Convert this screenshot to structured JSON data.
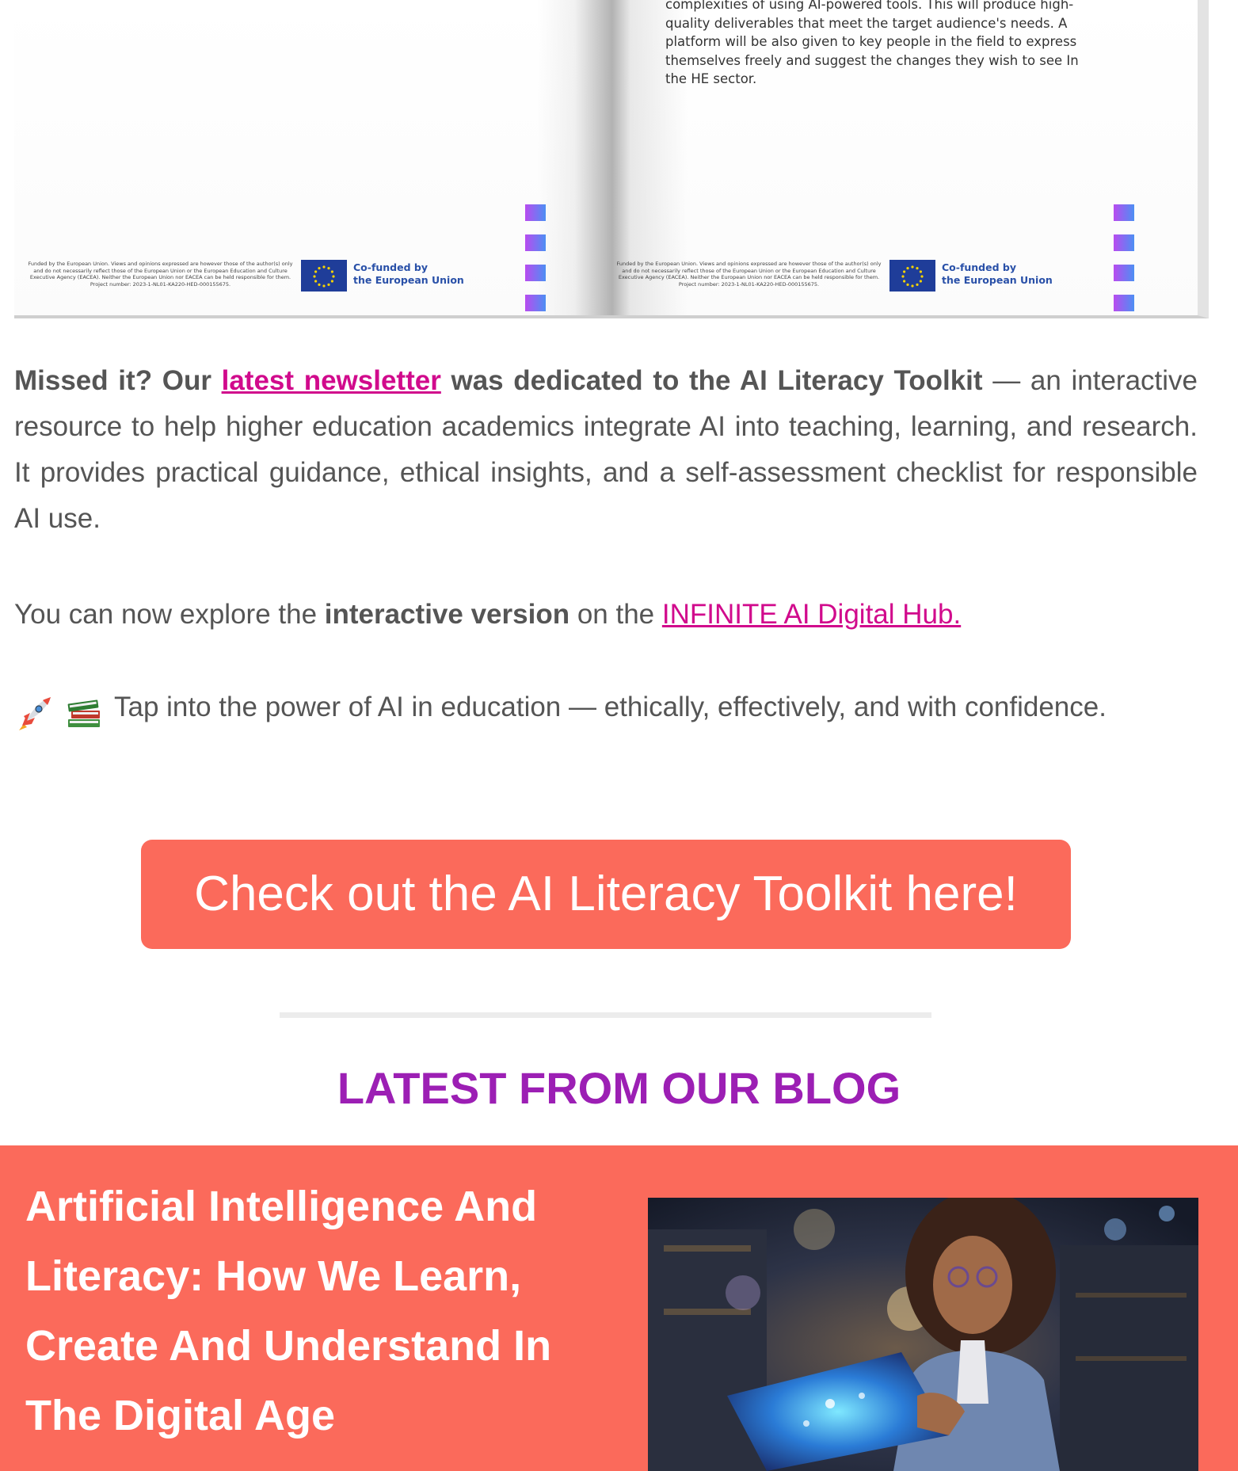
{
  "book": {
    "page_text_lines": [
      "complexities of using AI-powered tools. This will produce high-",
      "quality deliverables that meet the target audience's needs. A",
      "platform will be also given to key people in the field to express",
      "themselves freely and suggest the changes they wish to see In",
      "the HE sector."
    ],
    "disclaimer": "Funded by the European Union. Views and opinions expressed are however those of the author(s) only and do not necessarily reflect those of the European Union or the European Education and Culture Executive Agency (EACEA). Neither the European Union nor EACEA can be held responsible for them. Project number: 2023-1-NL01-KA220-HED-000155675.",
    "cofunded_line1": "Co-funded by",
    "cofunded_line2": "the European Union",
    "square_color_from": "#b84cf0",
    "square_color_to": "#4d8ff3"
  },
  "newsletter": {
    "prefix": "Missed it? Our ",
    "link_text": "latest newsletter",
    "suffix": " was dedicated to the AI Literacy Toolkit",
    "dash": " —",
    "body": " an interactive resource to help higher education academics integrate AI into teaching, learning, and research. It provides practical guidance, ethical insights, and a self-assessment checklist for responsible AI use."
  },
  "explore": {
    "prefix": "You can now explore the ",
    "bold": "interactive version",
    "middle": " on the ",
    "link_text": "INFINITE AI Digital Hub."
  },
  "tap": {
    "icons": [
      "rocket-icon",
      "books-icon"
    ],
    "text": "Tap into the power of AI in education — ethically, effectively, and with confidence."
  },
  "cta": {
    "label": "Check out the AI Literacy Toolkit here!",
    "color": "#fb6a5b"
  },
  "blog": {
    "heading": "LATEST FROM OUR BLOG",
    "heading_color": "#9c1fb4",
    "card_color": "#fb6a5b",
    "post_title": "Artificial Intelligence And Literacy: How We Learn, Create And Understand In The Digital Age"
  },
  "colors": {
    "link": "#d10a8c",
    "text": "#555555"
  }
}
